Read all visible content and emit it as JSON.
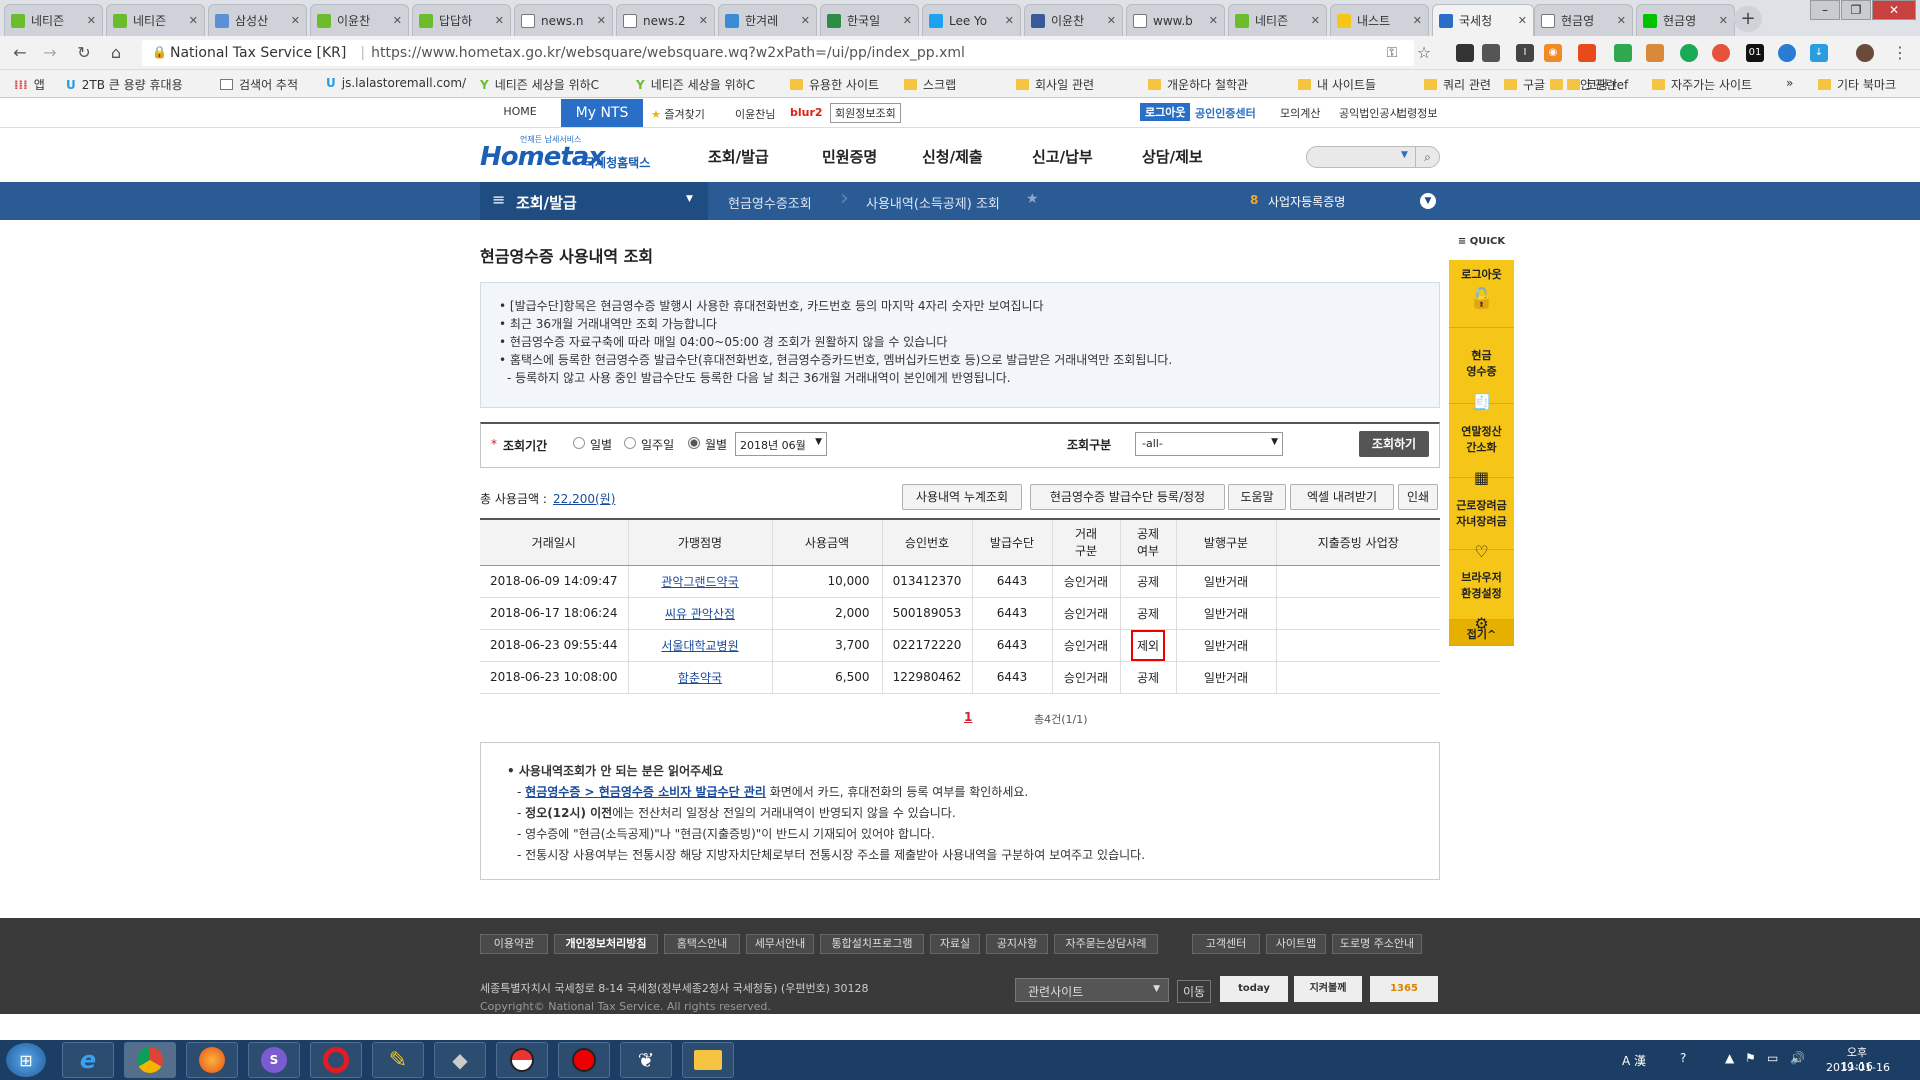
{
  "browser": {
    "tabs": [
      {
        "title": "네티즌",
        "icon": "naver-icon"
      },
      {
        "title": "네티즌",
        "icon": "naver-icon"
      },
      {
        "title": "삼성산",
        "icon": "globe-icon"
      },
      {
        "title": "이윤찬",
        "icon": "naver-icon"
      },
      {
        "title": "답답하",
        "icon": "naver-icon"
      },
      {
        "title": "news.n",
        "icon": "doc-icon"
      },
      {
        "title": "news.2",
        "icon": "doc-icon"
      },
      {
        "title": "한겨레",
        "icon": "hani-icon"
      },
      {
        "title": "한국일",
        "icon": "person-icon"
      },
      {
        "title": "Lee Yo",
        "icon": "twitter-icon"
      },
      {
        "title": "이윤찬",
        "icon": "facebook-icon"
      },
      {
        "title": "www.b",
        "icon": "doc-icon"
      },
      {
        "title": "네티즌",
        "icon": "naver-icon"
      },
      {
        "title": "내스트",
        "icon": "bookmark-icon"
      },
      {
        "title": "국세청",
        "icon": "hometax-icon"
      },
      {
        "title": "현금영",
        "icon": "google-icon"
      },
      {
        "title": "현금영",
        "icon": "line-icon"
      }
    ],
    "active_tab": 14,
    "site_label": "National Tax Service [KR]",
    "url": "https://www.hometax.go.kr/websquare/websquare.wq?w2xPath=/ui/pp/index_pp.xml",
    "bookmarks": [
      {
        "label": "앱"
      },
      {
        "label": "2TB 큰 용량 휴대용"
      },
      {
        "label": "검색어 추적"
      },
      {
        "label": "js.lalastoremall.com/"
      },
      {
        "label": "네티즌 세상을 위하C"
      },
      {
        "label": "네티즌 세상을 위하C"
      },
      {
        "label": "유용한 사이트"
      },
      {
        "label": "스크랩"
      },
      {
        "label": "회사일 관련"
      },
      {
        "label": "개운하다 철학관"
      },
      {
        "label": "내 사이트들"
      },
      {
        "label": "쿼리 관련"
      },
      {
        "label": "보안 관련"
      },
      {
        "label": "구글"
      },
      {
        "label": "코딩 ref"
      },
      {
        "label": "자주가는 사이트"
      },
      {
        "label": "»"
      },
      {
        "label": "기타 북마크"
      }
    ]
  },
  "topbar": {
    "home": "HOME",
    "mynts": "My NTS",
    "favorites": "즐겨찾기",
    "user": "이윤찬님",
    "blur": "blur2",
    "member_info": "회원정보조회",
    "logout": "로그아웃",
    "cert": "공인인증센터",
    "links": [
      "모의계산",
      "공익법인공시",
      "법령정보"
    ]
  },
  "header": {
    "logo_small": "언제든 납세서비스",
    "logo": "Hometax",
    "logo_sub": "국세청홈택스",
    "menus": [
      "조회/발급",
      "민원증명",
      "신청/제출",
      "신고/납부",
      "상담/제보"
    ]
  },
  "navbar": {
    "current": "조회/발급",
    "crumb1": "현금영수증조회",
    "crumb2": "사용내역(소득공제) 조회",
    "right_num": "8",
    "right_label": "사업자등록증명"
  },
  "page": {
    "title": "현금영수증 사용내역 조회",
    "notices": [
      "[발급수단]항목은 현금영수증 발행시 사용한 휴대전화번호, 카드번호 등의 마지막 4자리 숫자만 보여집니다",
      "최근 36개월 거래내역만 조회 가능합니다",
      "현금영수증 자료구축에 따라 매일 04:00~05:00 경 조회가 원활하지 않을 수 있습니다",
      "홈택스에 등록한 현금영수증 발급수단(휴대전화번호, 현금영수증카드번호, 멤버십카드번호 등)으로 발급받은 거래내역만 조회됩니다.",
      "- 등록하지 않고 사용 중인 발급수단도 등록한 다음 날 최근 36개월 거래내역이 본인에게 반영됩니다."
    ],
    "search": {
      "period_label": "조회기간",
      "options": [
        "일별",
        "일주일",
        "월별"
      ],
      "selected_option": 2,
      "month_value": "2018년 06월",
      "type_label": "조회구분",
      "type_value": "-all-",
      "submit": "조회하기"
    },
    "total_label": "총 사용금액 :",
    "total_value": "22,200(원)",
    "actions": [
      "사용내역 누계조회",
      "현금영수증 발급수단 등록/정정",
      "도움말",
      "엑셀 내려받기",
      "인쇄"
    ],
    "table": {
      "headers": [
        "거래일시",
        "가맹점명",
        "사용금액",
        "승인번호",
        "발급수단",
        "거래\n구분",
        "공제\n여부",
        "발행구분",
        "지출증빙 사업장"
      ],
      "rows": [
        [
          "2018-06-09 14:09:47",
          "관악그랜드약국",
          "10,000",
          "013412370",
          "6443",
          "승인거래",
          "공제",
          "일반거래",
          ""
        ],
        [
          "2018-06-17 18:06:24",
          "씨유 관악산점",
          "2,000",
          "500189053",
          "6443",
          "승인거래",
          "공제",
          "일반거래",
          ""
        ],
        [
          "2018-06-23 09:55:44",
          "서울대학교병원",
          "3,700",
          "022172220",
          "6443",
          "승인거래",
          "제외",
          "일반거래",
          ""
        ],
        [
          "2018-06-23 10:08:00",
          "함춘약국",
          "6,500",
          "122980462",
          "6443",
          "승인거래",
          "공제",
          "일반거래",
          ""
        ]
      ],
      "highlight_row": 2
    },
    "pagination": {
      "current": "1",
      "summary": "총4건(1/1)"
    },
    "guide": {
      "title": "사용내역조회가 안 되는 분은 읽어주세요",
      "link": "현금영수증 > 현금영수증 소비자 발급수단 관리",
      "line1_rest": " 화면에서 카드, 휴대전화의 등록 여부를 확인하세요.",
      "line2_bold": "정오(12시) 이전",
      "line2_rest": "에는 전산처리 일정상 전일의 거래내역이 반영되지 않을 수 있습니다.",
      "line3": "영수증에 \"현금(소득공제)\"나 \"현금(지출증빙)\"이 반드시 기재되어 있어야 합니다.",
      "line4": "전통시장 사용여부는 전통시장 해당 지방자치단체로부터 전통시장 주소를 제출받아 사용내역을 구분하여 보여주고 있습니다."
    }
  },
  "quick": {
    "title": "QUICK",
    "items": [
      "로그아웃",
      "현금\n영수증",
      "연말정산\n간소화",
      "근로장려금\n자녀장려금",
      "브라우저\n환경설정"
    ],
    "fold": "접기^"
  },
  "footer": {
    "links": [
      "이용약관",
      "개인정보처리방침",
      "홈택스안내",
      "세무서안내",
      "통합설치프로그램",
      "자료실",
      "공지사항",
      "자주묻는상담사례",
      "고객센터",
      "사이트맵",
      "도로명 주소안내"
    ],
    "address": "세종특별자치시 국세청로 8-14 국세청(정부세종2청사 국세청동) (우편번호) 30128",
    "copyright": "Copyright© National Tax Service. All rights reserved.",
    "related": "관련사이트",
    "go": "이동",
    "badges": [
      "today",
      "지켜볼께",
      "1365"
    ]
  },
  "taskbar": {
    "time": "오후 11:16",
    "date": "2019-01-16",
    "ime": "A 漢"
  }
}
